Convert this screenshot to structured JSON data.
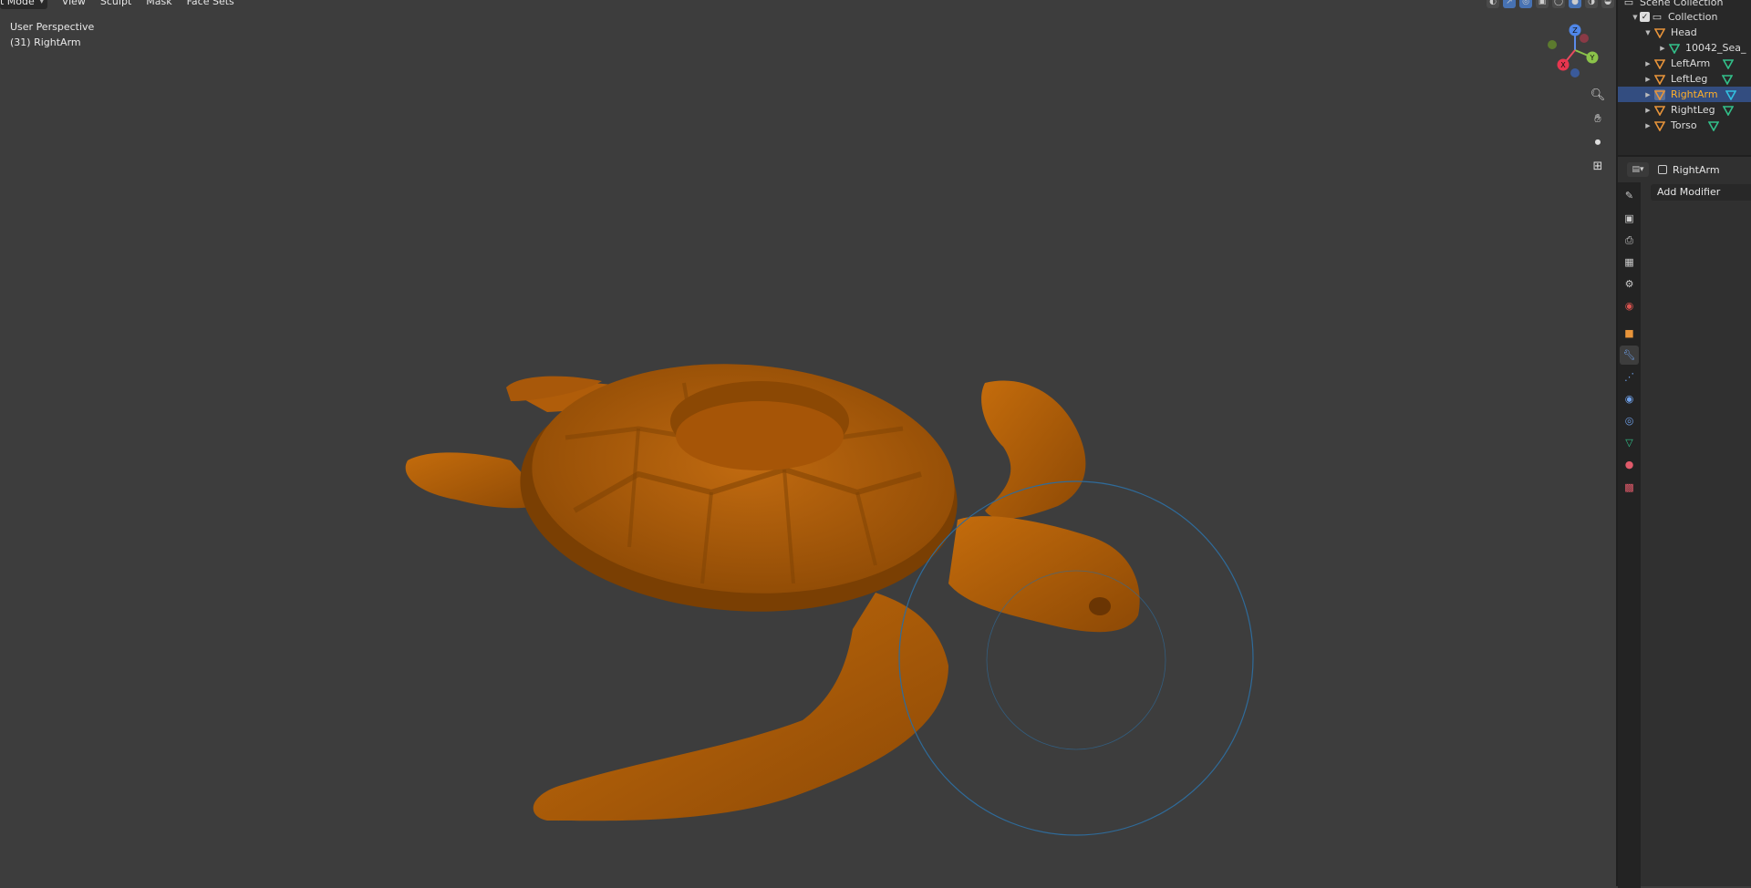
{
  "header": {
    "mode_label": "t Mode",
    "menus": [
      "View",
      "Sculpt",
      "Mask",
      "Face Sets"
    ]
  },
  "viewport": {
    "view_name": "User Perspective",
    "active_object": "(31) RightArm"
  },
  "gizmo": {
    "z": "Z",
    "y": "Y",
    "x": "X"
  },
  "outliner": {
    "scene_collection": "Scene Collection",
    "collection": "Collection",
    "items": [
      {
        "label": "Head",
        "selected": false
      },
      {
        "label": "10042_Sea_",
        "selected": false
      },
      {
        "label": "LeftArm",
        "selected": false
      },
      {
        "label": "LeftLeg",
        "selected": false
      },
      {
        "label": "RightArm",
        "selected": true
      },
      {
        "label": "RightLeg",
        "selected": false
      },
      {
        "label": "Torso",
        "selected": false
      }
    ]
  },
  "properties": {
    "object_name": "RightArm",
    "add_modifier": "Add Modifier"
  },
  "colors": {
    "viewport_bg": "#3d3d3d",
    "model": "#b35f08",
    "selection_blue": "#4772b3",
    "selected_text": "#ffaf29",
    "brush_circle": "#2f6b9a"
  },
  "icons": {
    "mesh": "mesh-triangle-icon",
    "object": "object-orange-icon",
    "zoom": "zoom-icon",
    "pan": "hand-icon",
    "camera": "camera-icon",
    "grid": "grid-icon"
  }
}
